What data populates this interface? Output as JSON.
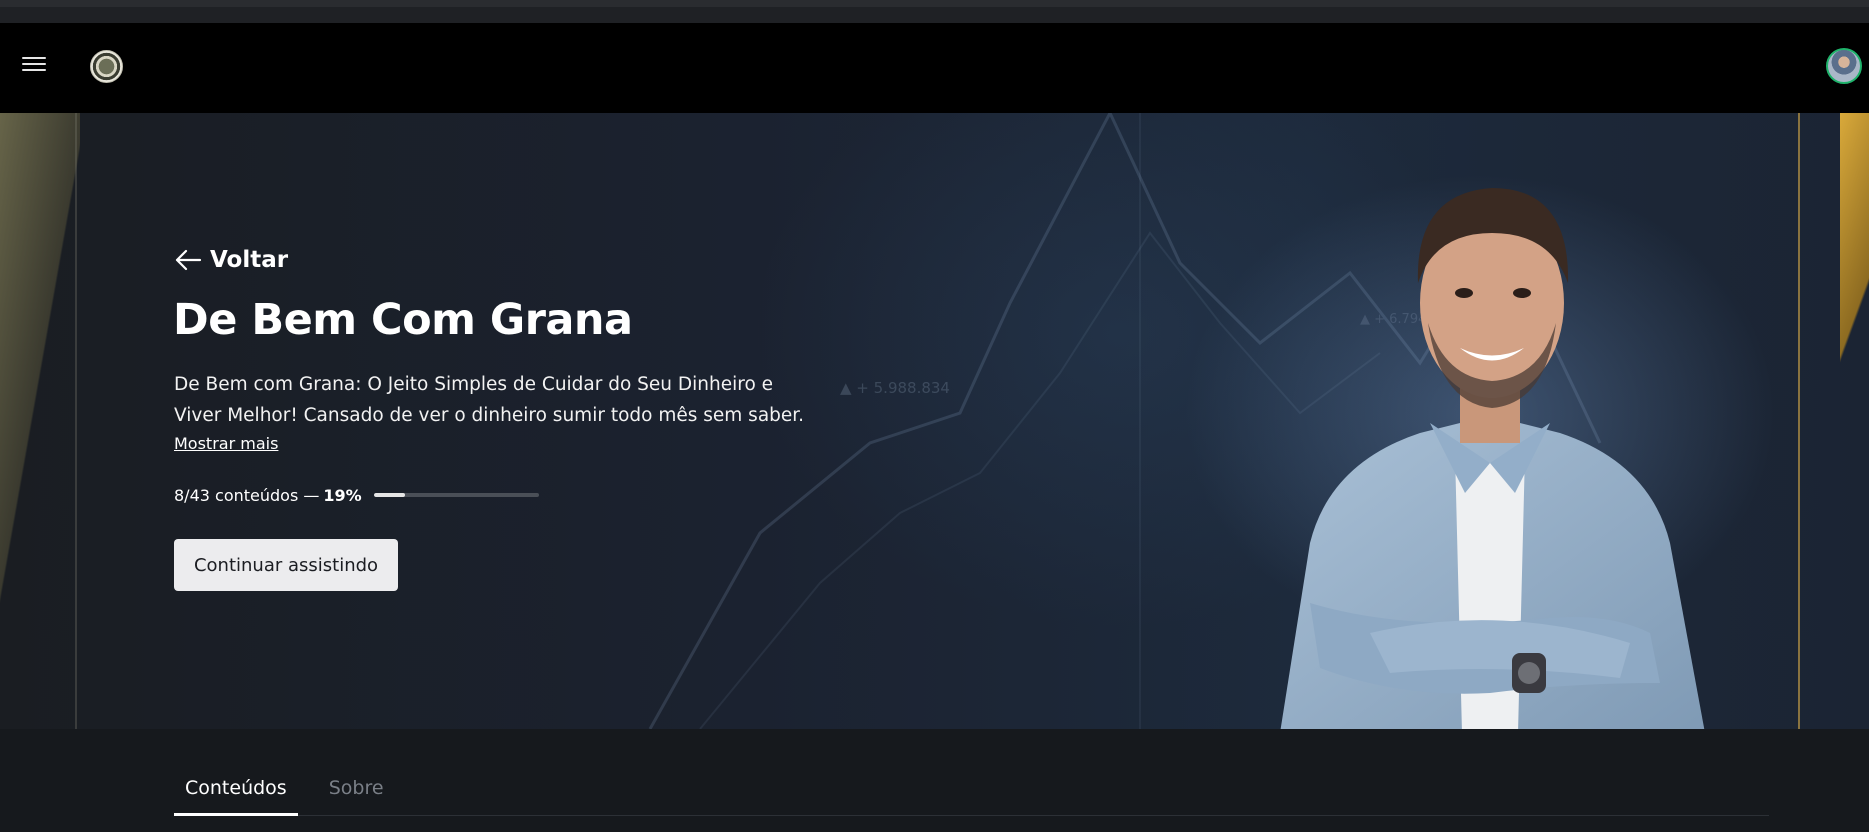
{
  "navbar": {
    "menu_icon": "hamburger-menu-icon",
    "logo_icon": "brand-logo-icon",
    "avatar_icon": "user-avatar-icon",
    "avatar_ring_color": "#1fb36b"
  },
  "hero": {
    "back_label": "Voltar",
    "back_icon": "arrow-left-icon",
    "title": "De Bem Com Grana",
    "description_line1": "De Bem com Grana: O Jeito Simples de Cuidar do Seu Dinheiro e",
    "description_line2": "Viver Melhor! Cansado de ver o dinheiro sumir todo mês sem saber...",
    "show_more": "Mostrar mais",
    "progress_text": "8/43 conteúdos —",
    "progress_percent": "19%",
    "progress_value": 0.19,
    "continue_button": "Continuar assistindo",
    "chart_label_1": "▲ + 5.988.834",
    "chart_label_2": "▲ + 6.794"
  },
  "tabs": [
    {
      "label": "Conteúdos",
      "active": true
    },
    {
      "label": "Sobre",
      "active": false
    }
  ],
  "colors": {
    "background": "#16191d",
    "accent_gold": "#d9a93a",
    "button_bg": "#ececee"
  }
}
